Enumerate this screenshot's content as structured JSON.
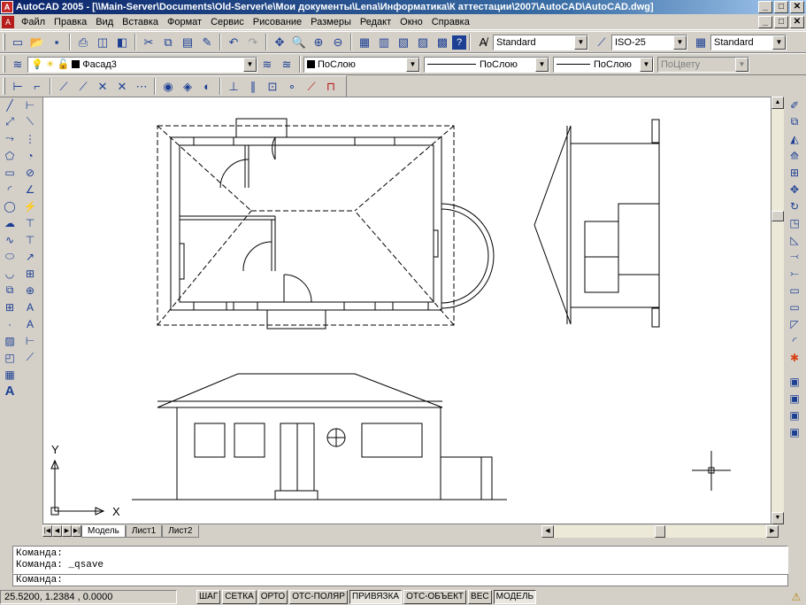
{
  "window": {
    "title": "AutoCAD 2005 - [\\\\Main-Server\\Documents\\Old-Server\\e\\Мои документы\\Lena\\Информатика\\К аттестации\\2007\\AutoCAD\\AutoCAD.dwg]",
    "min": "_",
    "max": "□",
    "close": "✕"
  },
  "menu": [
    "Файл",
    "Правка",
    "Вид",
    "Вставка",
    "Формат",
    "Сервис",
    "Рисование",
    "Размеры",
    "Редакт",
    "Окно",
    "Справка"
  ],
  "styles": {
    "text_style": "Standard",
    "dim_style": "ISO-25",
    "table_style": "Standard"
  },
  "layers": {
    "current_layer": "Фасад3",
    "color": "ПоСлою",
    "linetype": "ПоСлою",
    "lineweight": "ПоСлою",
    "plotstyle": "ПоЦвету"
  },
  "drawing": {
    "ucs_y": "Y",
    "ucs_x": "X"
  },
  "tabs": [
    "Модель",
    "Лист1",
    "Лист2"
  ],
  "command": {
    "line1": "Команда:",
    "line2": "Команда: _qsave",
    "prompt": "Команда:"
  },
  "status": {
    "coords": "25.5200, 1.2384 , 0.0000",
    "toggles": [
      {
        "label": "ШАГ",
        "on": false
      },
      {
        "label": "СЕТКА",
        "on": false
      },
      {
        "label": "ОРТО",
        "on": false
      },
      {
        "label": "ОТС-ПОЛЯР",
        "on": false
      },
      {
        "label": "ПРИВЯЗКА",
        "on": true
      },
      {
        "label": "ОТС-ОБЪЕКТ",
        "on": false
      },
      {
        "label": "ВЕС",
        "on": false
      },
      {
        "label": "МОДЕЛЬ",
        "on": true
      }
    ]
  },
  "icons": {
    "draw_toolbar": [
      "line-icon",
      "construction-line-icon",
      "polyline-icon",
      "polygon-icon",
      "rectangle-icon",
      "arc-icon",
      "circle-icon",
      "revcloud-icon",
      "spline-icon",
      "ellipse-icon",
      "ellipse-arc-icon",
      "insert-block-icon",
      "make-block-icon",
      "point-icon",
      "hatch-icon",
      "region-icon",
      "table-icon",
      "mtext-icon"
    ],
    "modify_toolbar": [
      "erase-icon",
      "copy-icon",
      "mirror-icon",
      "offset-icon",
      "array-icon",
      "move-icon",
      "rotate-icon",
      "scale-icon",
      "stretch-icon",
      "trim-icon",
      "extend-icon",
      "break-icon",
      "join-icon",
      "chamfer-icon",
      "fillet-icon",
      "explode-icon"
    ]
  }
}
